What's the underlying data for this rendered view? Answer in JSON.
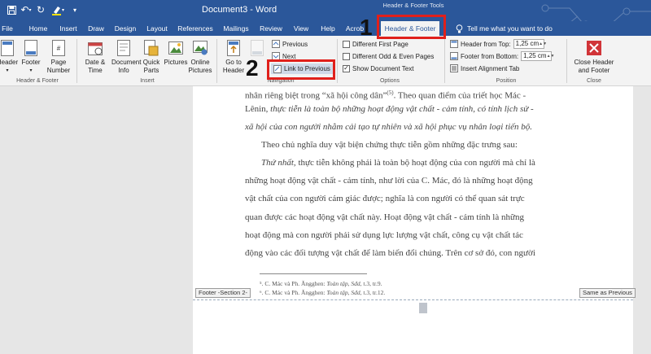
{
  "title_bar": {
    "document_title": "Document3  -  Word",
    "contextual_group": "Header & Footer Tools",
    "qa_icons": [
      "save-icon",
      "undo-icon",
      "redo-icon",
      "highlight-icon",
      "customize-icon"
    ]
  },
  "tabs": [
    "File",
    "Home",
    "Insert",
    "Draw",
    "Design",
    "Layout",
    "References",
    "Mailings",
    "Review",
    "View",
    "Help",
    "Acrob",
    "Header & Footer"
  ],
  "tell_me": "Tell me what you want to do",
  "ribbon": {
    "hf_group": {
      "buttons": [
        "Header",
        "Footer",
        "Page Number"
      ],
      "label": "Header & Footer"
    },
    "insert_group": {
      "buttons": [
        "Date & Time",
        "Document Info",
        "Quick Parts",
        "Pictures",
        "Online Pictures"
      ],
      "label": "Insert"
    },
    "nav_group": {
      "goto": "Go to Header",
      "items": [
        "Previous",
        "Next",
        "Link to Previous"
      ],
      "label": "Navigation"
    },
    "options_group": {
      "items": [
        {
          "label": "Different First Page",
          "checked": false
        },
        {
          "label": "Different Odd & Even Pages",
          "checked": false
        },
        {
          "label": "Show Document Text",
          "checked": true
        }
      ],
      "label": "Options"
    },
    "position_group": {
      "header_from_top": {
        "label": "Header from Top:",
        "value": "1,25 cm"
      },
      "footer_from_bottom": {
        "label": "Footer from Bottom:",
        "value": "1,25 cm"
      },
      "insert_alignment_tab": "Insert Alignment Tab",
      "label": "Position"
    },
    "close_group": {
      "button": "Close Header and Footer",
      "label": "Close"
    }
  },
  "annotations": {
    "step1": "1",
    "step2": "2"
  },
  "document": {
    "lines": [
      {
        "pre": "nhân riêng biệt trong “xã hội công dân”",
        "sup": "(5)",
        "post": ". Theo quan điểm của triết học Mác -",
        "italic": false
      },
      {
        "pre": "Lênin, ",
        "italic_part": "thực tiễn là toàn bộ những hoạt động vật chất - cảm tính, có tính lịch sử -"
      },
      {
        "italic_full": "xã hội của con người nhằm cải tạo tự nhiên và xã hội phục vụ nhân loại tiến bộ."
      },
      {
        "plain": "Theo chủ nghĩa duy vật biện chứng thực tiễn gồm những đặc trưng sau:"
      },
      {
        "italic_lead": "Thứ nhất,",
        "rest": " thực tiễn không phải là toàn bộ hoạt động của con người mà chỉ là"
      },
      {
        "plain": "những hoạt động vật chất - cảm tính, như lời của C. Mác, đó là những hoạt động"
      },
      {
        "plain": "vật chất của con người cảm giác được; nghĩa là con người có thể quan sát trực"
      },
      {
        "plain": "quan được các hoạt động vật chất này. Hoạt động vật chất - cảm tính là những"
      },
      {
        "plain": "hoạt động mà con người phải sử dụng lực lượng vật chất, công cụ vật chất tác"
      },
      {
        "plain": "động vào các đối tượng vật chất để làm biến đổi chúng. Trên cơ sở đó, con người"
      }
    ],
    "footnotes": [
      {
        "pre": "⁵. C. Mác và Ph. Ăngghen: ",
        "italic": "Toàn tập, Sđd,",
        "post": " t.3, tr.9."
      },
      {
        "pre": "⁶. C. Mác và Ph. Ăngghen: ",
        "italic": "Toàn tập, Sđd,",
        "post": " t.3, tr.12."
      }
    ],
    "footer_tag": "Footer -Section 2-",
    "same_as_previous": "Same as Previous"
  }
}
